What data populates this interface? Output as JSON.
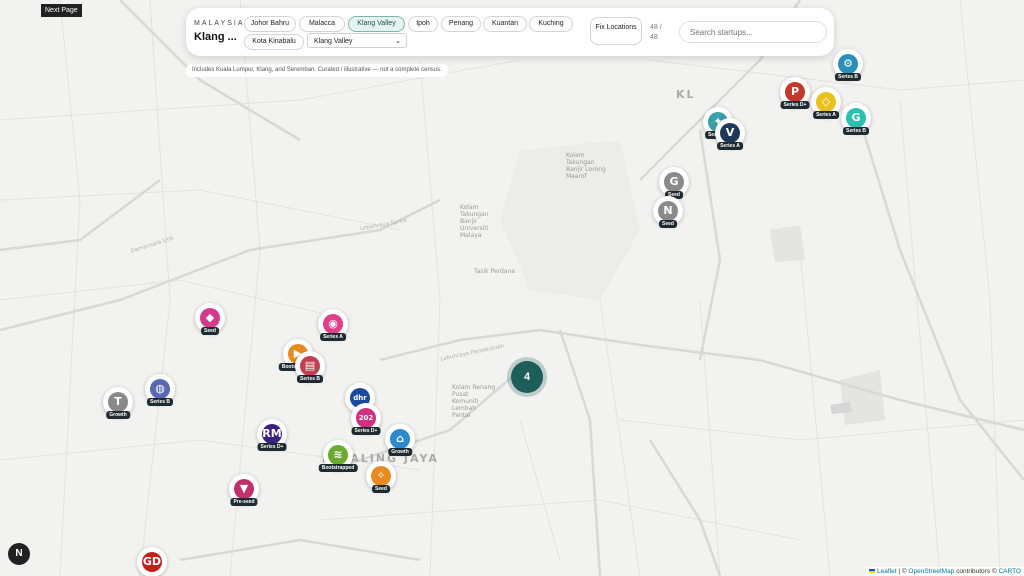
{
  "next_page": "Next Page",
  "header": {
    "kicker": "MALAYSIA",
    "title": "Klang ...",
    "cities": [
      {
        "label": "Johor Bahru",
        "active": false
      },
      {
        "label": "Malacca",
        "active": false
      },
      {
        "label": "Klang Valley",
        "active": true
      },
      {
        "label": "Ipoh",
        "active": false
      },
      {
        "label": "Penang",
        "active": false
      },
      {
        "label": "Kuantan",
        "active": false
      },
      {
        "label": "Kuching",
        "active": false
      },
      {
        "label": "Kota Kinabalu",
        "active": false
      }
    ],
    "region_select": "Klang Valley",
    "fix_locations": "Fix Locations",
    "count": "48 / 48",
    "search_placeholder": "Search startups..."
  },
  "note": "Includes Kuala Lumpur, Klang, and Seremban. Curated / illustrative — not a complete census.",
  "cluster_count": "4",
  "n_button": "N",
  "map_labels": {
    "kl": "KL",
    "petaling_jaya": "PETALING JAYA",
    "kolam": "Kolam Takungan Banjir Lorong Maarof",
    "bangsar": "Kolam Takungan Banjir Universiti Malaya",
    "kerinchi": "Kolam Renang Pusat Komuniti Lembah Pantai",
    "taman_tasik": "Tasik Perdana"
  },
  "road_labels": {
    "damansara": "Damansara Link",
    "sprint": "Lebuhraya Sprint",
    "federal": "Lebuhraya Persekutuan"
  },
  "markers": [
    {
      "name": "gear-startup",
      "logo": "⚙",
      "color": "#2a8fb8",
      "tag": "Series B"
    },
    {
      "name": "p-startup",
      "logo": "P",
      "color": "#c0392b",
      "tag": "Series D+"
    },
    {
      "name": "yellow-startup",
      "logo": "◇",
      "color": "#e8c020",
      "tag": "Series A"
    },
    {
      "name": "leaf-startup",
      "logo": "G",
      "color": "#2cc0b0",
      "tag": "Series B"
    },
    {
      "name": "teal-shape-startup",
      "logo": "✦",
      "color": "#3aa0a8",
      "tag": "Series A"
    },
    {
      "name": "v-startup",
      "logo": "V",
      "color": "#1e3a5a",
      "tag": "Series A"
    },
    {
      "name": "g-startup",
      "logo": "G",
      "color": "#8a8a8a",
      "tag": "Seed"
    },
    {
      "name": "n-startup",
      "logo": "N",
      "color": "#8a8a8a",
      "tag": "Seed"
    },
    {
      "name": "pink-badge-startup",
      "logo": "◆",
      "color": "#d43a8a",
      "tag": "Seed"
    },
    {
      "name": "panda-startup",
      "logo": "◉",
      "color": "#e0408a",
      "tag": "Series A"
    },
    {
      "name": "orange-play-startup",
      "logo": "▶",
      "color": "#e88a20",
      "tag": "Bootstrapped"
    },
    {
      "name": "doc-startup",
      "logo": "▤",
      "color": "#c04050",
      "tag": "Series B"
    },
    {
      "name": "t-startup",
      "logo": "T",
      "color": "#8a8a8a",
      "tag": "Growth"
    },
    {
      "name": "globe-startup",
      "logo": "◍",
      "color": "#5a6ab0",
      "tag": "Series B"
    },
    {
      "name": "dhr-startup",
      "logo": "dhr",
      "color": "#1a4aa0",
      "tag": ""
    },
    {
      "name": "202-startup",
      "logo": "202",
      "color": "#d03080",
      "tag": "Series D+"
    },
    {
      "name": "house-startup",
      "logo": "⌂",
      "color": "#2a8ad0",
      "tag": "Growth"
    },
    {
      "name": "rm-startup",
      "logo": "RM",
      "color": "#3a2080",
      "tag": "Series D+"
    },
    {
      "name": "green-wave-startup",
      "logo": "≋",
      "color": "#6aaa30",
      "tag": "Bootstrapped"
    },
    {
      "name": "bird-startup",
      "logo": "✧",
      "color": "#e88a20",
      "tag": "Seed"
    },
    {
      "name": "v-pink-startup",
      "logo": "▼",
      "color": "#c0306a",
      "tag": "Pre-seed"
    },
    {
      "name": "gdex-startup",
      "logo": "GD",
      "color": "#c02020",
      "tag": ""
    }
  ],
  "attribution": {
    "leaflet": "Leaflet",
    "sep": " | © ",
    "osm": "OpenStreetMap",
    "contrib": " contributors © ",
    "carto": "CARTO"
  }
}
